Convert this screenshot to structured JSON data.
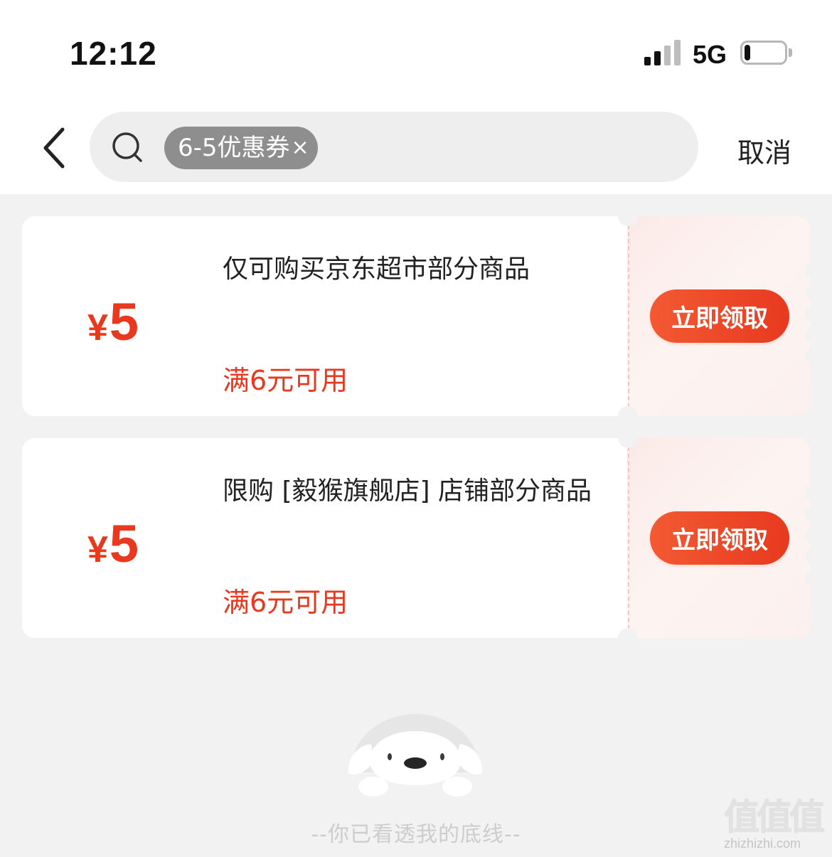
{
  "status_bar": {
    "time": "12:12",
    "network": "5G",
    "signal_bars_active": 2,
    "battery_level": 0.15
  },
  "search": {
    "chip_label": "6-5优惠券",
    "chip_close_glyph": "×",
    "cancel_label": "取消"
  },
  "coupons": [
    {
      "currency": "¥",
      "amount": "5",
      "description": "仅可购买京东超市部分商品",
      "condition": "满6元可用",
      "button_label": "立即领取"
    },
    {
      "currency": "¥",
      "amount": "5",
      "description": "限购 [毅猴旗舰店] 店铺部分商品",
      "condition": "满6元可用",
      "button_label": "立即领取"
    }
  ],
  "footer": {
    "end_text": "--你已看透我的底线--"
  },
  "watermark": {
    "logo": "值值值",
    "url": "zhizhizhi.com"
  },
  "colors": {
    "accent": "#e8381d",
    "page_bg": "#f2f2f2",
    "chip_bg": "#8e8e8e"
  },
  "icons": [
    "back-chevron-icon",
    "search-icon",
    "close-icon",
    "signal-icon",
    "battery-icon",
    "mascot-dog-icon"
  ]
}
